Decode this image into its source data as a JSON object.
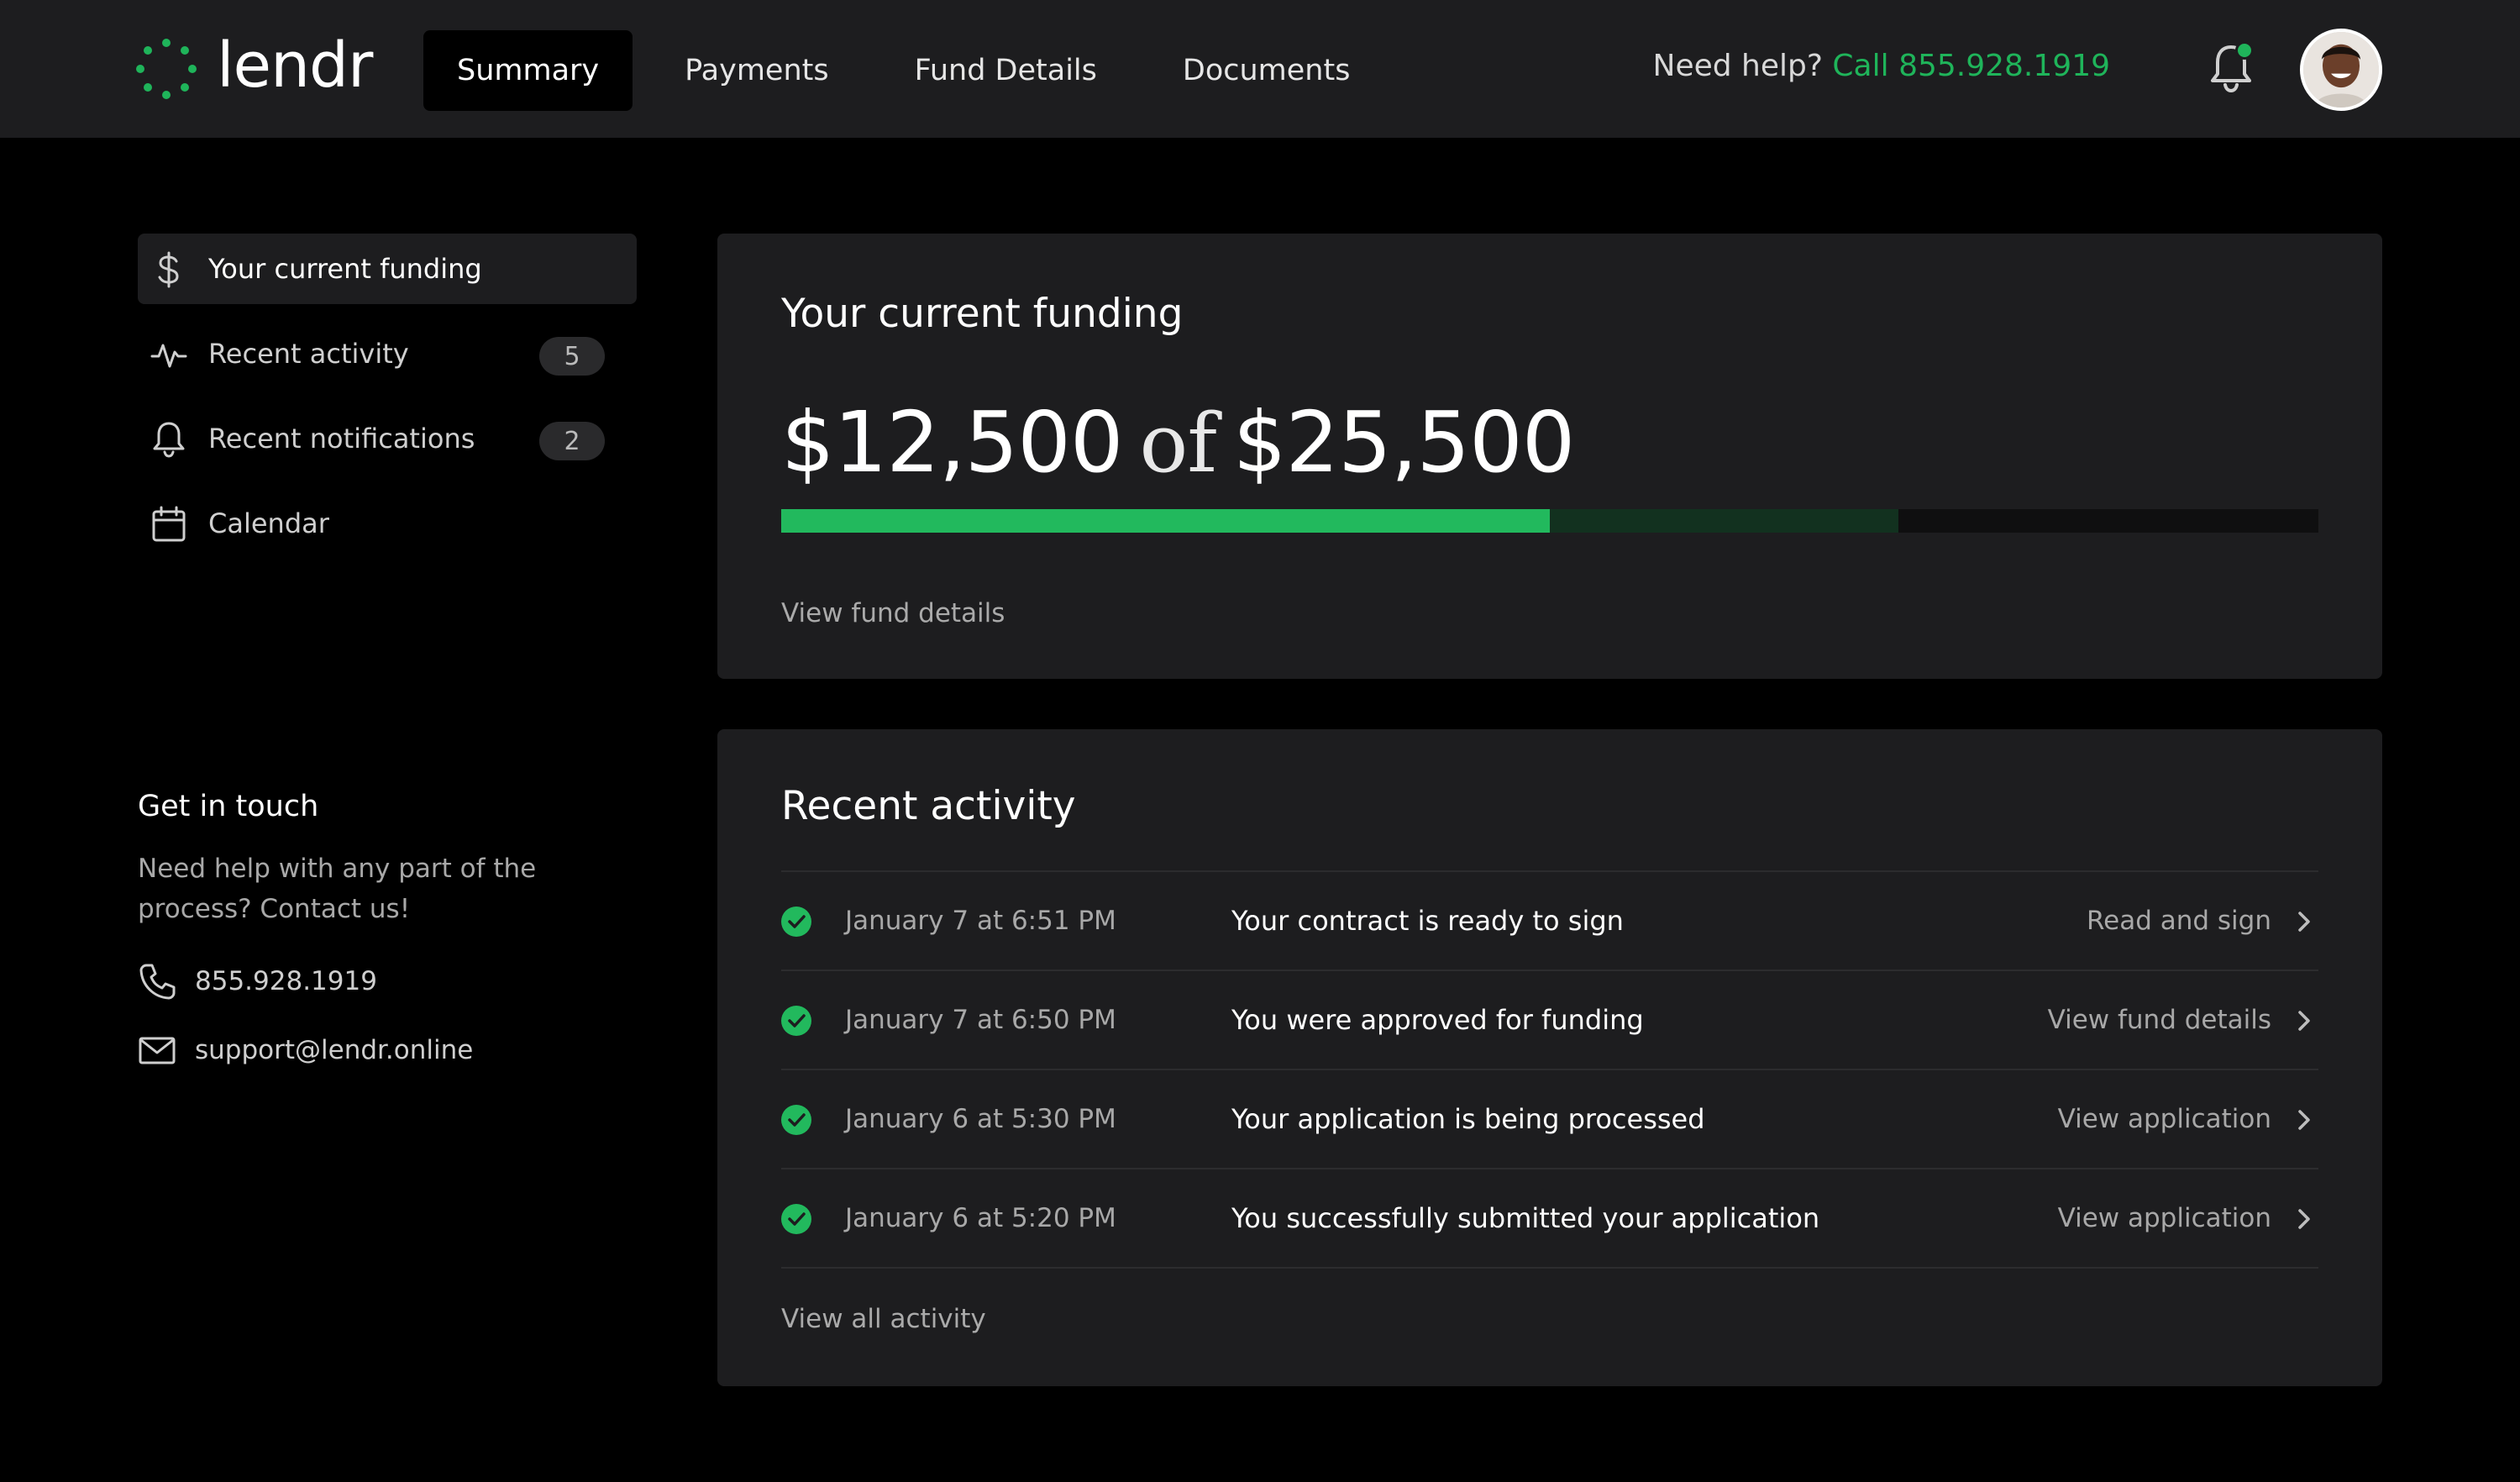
{
  "brand": {
    "name": "lendr",
    "accent": "#1fb45a"
  },
  "nav": {
    "items": [
      {
        "label": "Summary",
        "active": true
      },
      {
        "label": "Payments",
        "active": false
      },
      {
        "label": "Fund Details",
        "active": false
      },
      {
        "label": "Documents",
        "active": false
      }
    ]
  },
  "header": {
    "help_text": "Need help?",
    "help_call": "Call 855.928.1919",
    "notification_icon": "bell-icon",
    "has_unread": true,
    "avatar_icon": "user-avatar"
  },
  "sidebar": {
    "items": [
      {
        "label": "Your current funding",
        "icon": "dollar-icon",
        "active": true,
        "badge": ""
      },
      {
        "label": "Recent activity",
        "icon": "activity-icon",
        "active": false,
        "badge": "5"
      },
      {
        "label": "Recent notifications",
        "icon": "bell-icon",
        "active": false,
        "badge": "2"
      },
      {
        "label": "Calendar",
        "icon": "calendar-icon",
        "active": false,
        "badge": ""
      }
    ]
  },
  "get_in_touch": {
    "title": "Get in touch",
    "text": "Need help with any part of the process? Contact us!",
    "phone": "855.928.1919",
    "email": "support@lendr.online"
  },
  "funding": {
    "title": "Your current funding",
    "current": "$12,500",
    "of": "of",
    "total": "$25,500",
    "progress_fraction": 0.5,
    "pending_fraction": 0.227,
    "link": "View fund details"
  },
  "activity": {
    "title": "Recent activity",
    "rows": [
      {
        "date": "January 7 at 6:51 PM",
        "message": "Your contract is ready to sign",
        "action": "Read and sign"
      },
      {
        "date": "January 7 at 6:50 PM",
        "message": "You were approved for funding",
        "action": "View fund details"
      },
      {
        "date": "January 6 at 5:30 PM",
        "message": "Your application is being processed",
        "action": "View application"
      },
      {
        "date": "January 6 at 5:20 PM",
        "message": "You successfully submitted your application",
        "action": "View application"
      }
    ],
    "view_all": "View all activity"
  }
}
